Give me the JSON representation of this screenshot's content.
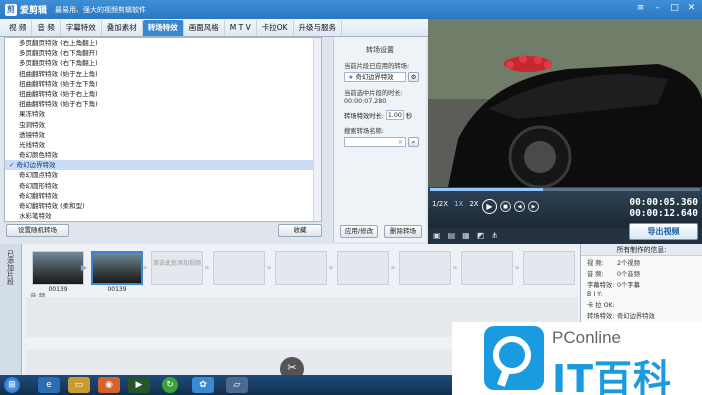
{
  "app": {
    "name": "爱剪辑",
    "slogan": "最易用、强大的视频剪辑软件"
  },
  "tabs": [
    "视 频",
    "音 频",
    "字幕特效",
    "叠加素材",
    "转场特效",
    "画面风格",
    "M T V",
    "卡拉OK",
    "升级与服务"
  ],
  "active_tab_index": 4,
  "effects": [
    "多页翻页特效 (右上角翻上)",
    "多页翻页特效 (右下角翻开)",
    "多页翻页特效 (右下角翻上)",
    "扭曲翻转特效 (始于左上角)",
    "扭曲翻转特效 (始于左下角)",
    "扭曲翻转特效 (始于右上角)",
    "扭曲翻转特效 (始于右下角)",
    "果冻特效",
    "虫洞特效",
    "透镜特效",
    "光线特效",
    "奇幻颜色特效",
    "奇幻边界特效",
    "奇幻圆点特效",
    "奇幻圆形特效",
    "奇幻翻转特效",
    "奇幻翻转特效 (柔和型)",
    "水彩笔特效"
  ],
  "selected_effect": "奇幻边界特效",
  "list_buttons": {
    "random": "设置随机转场",
    "favorite": "收藏"
  },
  "settings": {
    "title": "转场设置",
    "applied_label": "当前片段已应用的转场:",
    "applied_value": "奇幻边界特效",
    "duration_label": "当前选中片段的时长:",
    "duration_value": "00:00:07.280",
    "transition_time_label": "转场特效时长:",
    "transition_time_value": "1.00",
    "transition_time_unit": "秒",
    "search_label": "搜索转场名称:",
    "apply_btn": "应用/修改",
    "delete_btn": "删除转场"
  },
  "player": {
    "speeds": [
      "1/2X",
      "1X",
      "2X"
    ],
    "time_current": "00:00:05.360",
    "time_total": "00:00:12.640",
    "progress": 0.42
  },
  "export_label": "导出视频",
  "timeline": {
    "sidebar_label": "已添加片段",
    "clips": [
      {
        "label": "00139"
      },
      {
        "label": "00139"
      }
    ],
    "placeholder": "双击此处添加视频",
    "audio_label": "音 频"
  },
  "info": {
    "title": "所有制作的信息:",
    "rows": [
      {
        "k": "视 频:",
        "v": "2个视频"
      },
      {
        "k": "音 频:",
        "v": "0个音频"
      },
      {
        "k": "字幕特效:",
        "v": "0个字幕"
      },
      {
        "k": "B  I  Y:",
        "v": ""
      },
      {
        "k": "卡 拉 OK:",
        "v": ""
      },
      {
        "k": "转场特效:",
        "v": "奇幻边界特效"
      }
    ]
  },
  "watermark": {
    "brand": "PConline",
    "sub": "IT百科"
  },
  "colors": {
    "accent": "#2d77c2",
    "selection": "#c9def4",
    "watermark": "#1a9be0"
  }
}
